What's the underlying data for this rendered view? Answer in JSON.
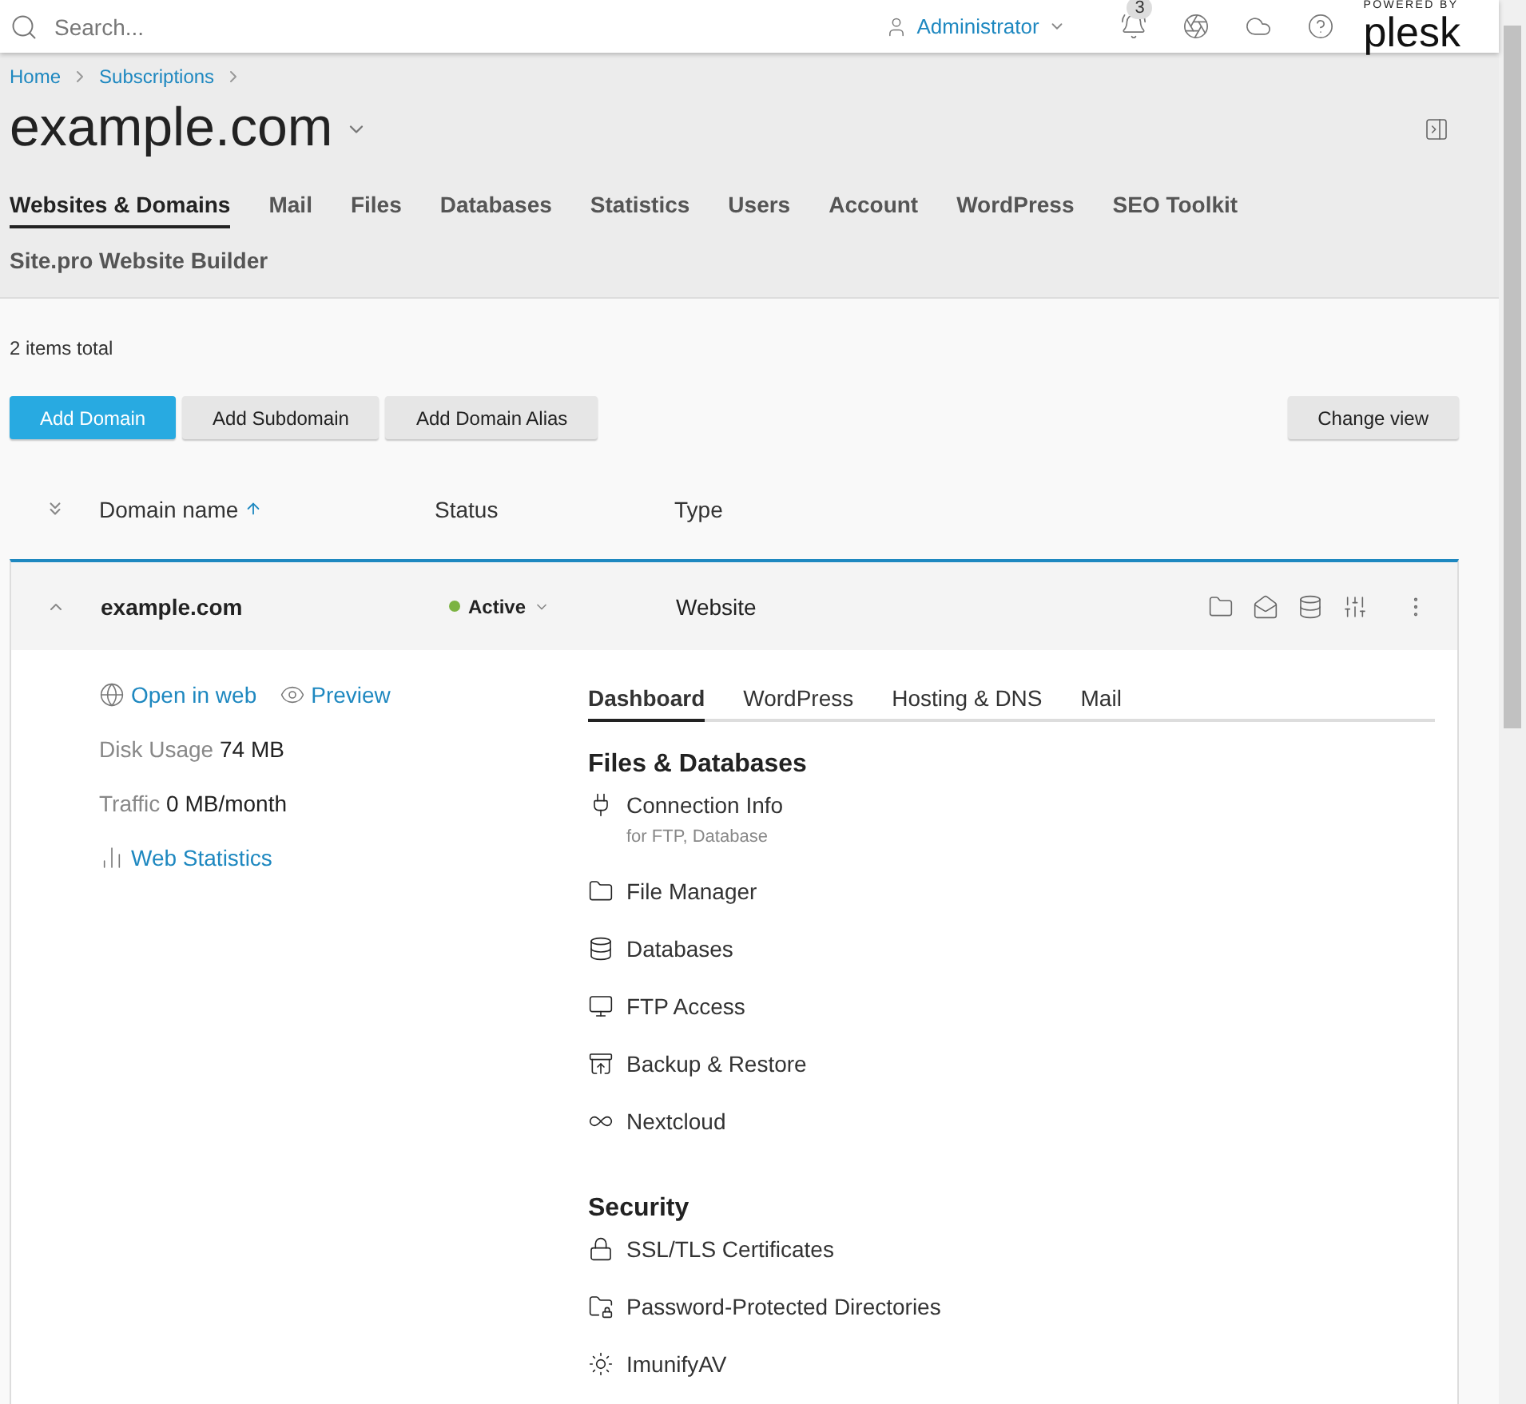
{
  "header": {
    "search": {
      "placeholder": "Search..."
    },
    "user": "Administrator",
    "notifications": "3",
    "logo": {
      "tagline": "POWERED BY",
      "name": "plesk"
    }
  },
  "breadcrumbs": [
    "Home",
    "Subscriptions"
  ],
  "title": "example.com",
  "tabs": [
    {
      "label": "Websites & Domains",
      "selected": true
    },
    {
      "label": "Mail",
      "selected": false
    },
    {
      "label": "Files",
      "selected": false
    },
    {
      "label": "Databases",
      "selected": false
    },
    {
      "label": "Statistics",
      "selected": false
    },
    {
      "label": "Users",
      "selected": false
    },
    {
      "label": "Account",
      "selected": false
    },
    {
      "label": "WordPress",
      "selected": false
    },
    {
      "label": "SEO Toolkit",
      "selected": false
    },
    {
      "label": "Site.pro Website Builder",
      "selected": false
    }
  ],
  "items_total": "2 items total",
  "toolbar": [
    {
      "label": "Add Domain",
      "kind": "primary"
    },
    {
      "label": "Add Subdomain",
      "kind": "secondary"
    },
    {
      "label": "Add Domain Alias",
      "kind": "secondary"
    }
  ],
  "change_view": "Change view",
  "table": {
    "columns": [
      "Domain name",
      "Status",
      "Type"
    ],
    "rows": [
      {
        "domain": "example.com",
        "status": "Active",
        "type": "Website",
        "expanded": true
      }
    ]
  },
  "details": {
    "links": [
      "Open in web",
      "Preview"
    ],
    "stats": [
      {
        "label": "Disk Usage",
        "value": "74 MB"
      },
      {
        "label": "Traffic",
        "value": "0 MB/month"
      }
    ],
    "web_statistics": "Web Statistics",
    "tabs": [
      {
        "label": "Dashboard",
        "selected": true
      },
      {
        "label": "WordPress",
        "selected": false
      },
      {
        "label": "Hosting & DNS",
        "selected": false
      },
      {
        "label": "Mail",
        "selected": false
      }
    ],
    "sections": [
      {
        "title": "Files & Databases",
        "items": [
          {
            "label": "Connection Info",
            "note": "for FTP, Database"
          },
          {
            "label": "File Manager"
          },
          {
            "label": "Databases"
          },
          {
            "label": "FTP Access"
          },
          {
            "label": "Backup & Restore"
          },
          {
            "label": "Nextcloud"
          }
        ]
      },
      {
        "title": "Security",
        "items": [
          {
            "label": "SSL/TLS Certificates"
          },
          {
            "label": "Password-Protected Directories"
          },
          {
            "label": "ImunifyAV"
          }
        ]
      }
    ]
  }
}
